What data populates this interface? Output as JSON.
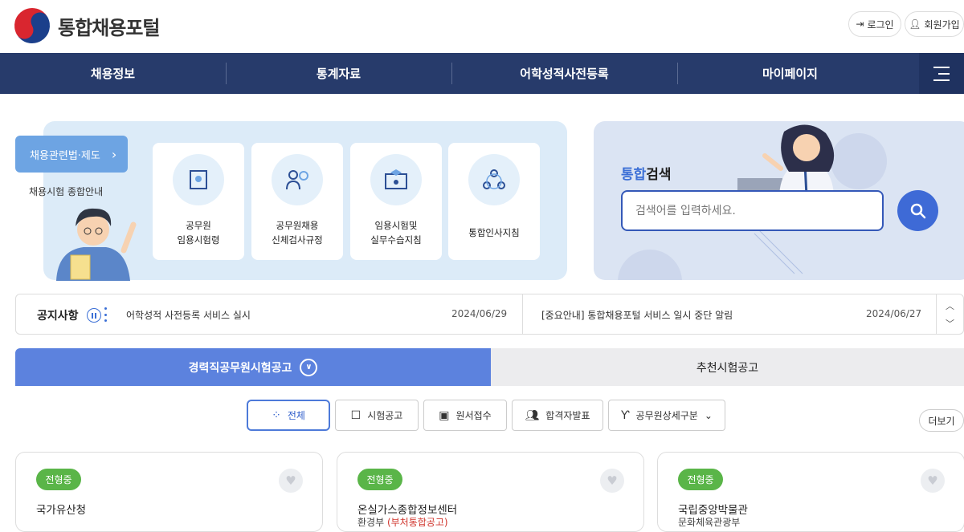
{
  "header": {
    "logo_text": "통합채용포털",
    "login": "로그인",
    "signup": "회원가입"
  },
  "nav": {
    "items": [
      "채용정보",
      "통계자료",
      "어학성적사전등록",
      "마이페이지"
    ]
  },
  "law": {
    "button_label": "채용관련법·제도",
    "subtitle": "채용시험 종합안내"
  },
  "cards": [
    {
      "label": "공무원\n임용시험령"
    },
    {
      "label": "공무원채용\n신체검사규정"
    },
    {
      "label": "임용시험및\n실무수습지침"
    },
    {
      "label": "통합인사지침"
    }
  ],
  "search": {
    "title_highlight": "통합",
    "title_rest": "검색",
    "placeholder": "검색어를 입력하세요."
  },
  "notice": {
    "title": "공지사항",
    "items": [
      {
        "text": "어학성적 사전등록 서비스 실시",
        "date": "2024/06/29"
      },
      {
        "text": "[중요안내] 통합채용포털 서비스 일시 중단 알림",
        "date": "2024/06/27"
      }
    ]
  },
  "tabs": {
    "active": "경력직공무원시험공고",
    "inactive": "추천시험공고"
  },
  "filters": [
    "전체",
    "시험공고",
    "원서접수",
    "합격자발표",
    "공무원상세구분"
  ],
  "more": "더보기",
  "result_cards": [
    {
      "badge": "전형중",
      "org": "국가유산청",
      "sub": "",
      "sub_tag": ""
    },
    {
      "badge": "전형중",
      "org": "온실가스종합정보센터",
      "sub": "환경부",
      "sub_tag": "(부처통합공고)"
    },
    {
      "badge": "전형중",
      "org": "국립중앙박물관",
      "sub": "문화체육관광부",
      "sub_tag": ""
    }
  ],
  "colors": {
    "nav_bg": "#273b6b",
    "accent_blue": "#5c82de",
    "badge_green": "#5ab548"
  }
}
